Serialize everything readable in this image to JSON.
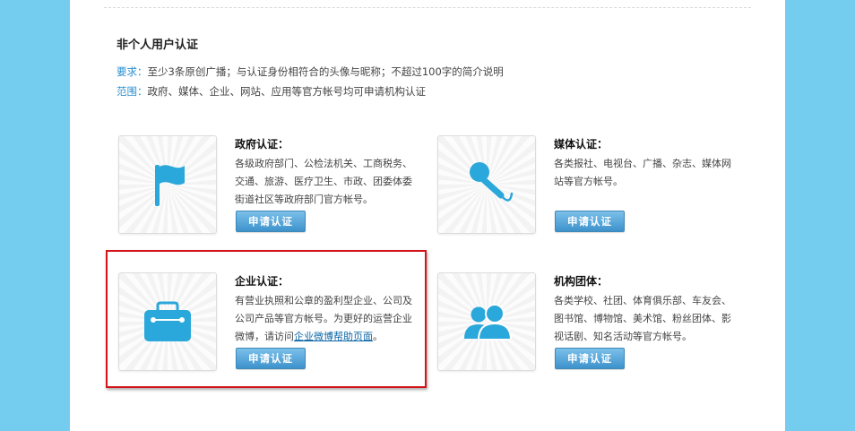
{
  "header": {
    "title": "非个人用户认证",
    "requirement_key": "要求：",
    "requirement_text": "至少3条原创广播；与认证身份相符合的头像与昵称；不超过100字的简介说明",
    "scope_key": "范围：",
    "scope_text": "政府、媒体、企业、网站、应用等官方帐号均可申请机构认证"
  },
  "cards": [
    {
      "title": "政府认证：",
      "icon": "flag-icon",
      "desc": "各级政府部门、公检法机关、工商税务、交通、旅游、医疗卫生、市政、团委体委街道社区等政府部门官方帐号。",
      "button": "申请认证"
    },
    {
      "title": "媒体认证：",
      "icon": "microphone-icon",
      "desc": "各类报社、电视台、广播、杂志、媒体网站等官方帐号。",
      "button": "申请认证"
    },
    {
      "title": "企业认证：",
      "icon": "briefcase-icon",
      "desc_before": "有营业执照和公章的盈利型企业、公司及公司产品等官方帐号。为更好的运营企业微博，请访问",
      "desc_link": "企业微博帮助页面",
      "desc_after": "。",
      "button": "申请认证"
    },
    {
      "title": "机构团体：",
      "icon": "group-icon",
      "desc": "各类学校、社团、体育俱乐部、车友会、图书馆、博物馆、美术馆、粉丝团体、影视话剧、知名活动等官方帐号。",
      "button": "申请认证"
    }
  ],
  "colors": {
    "background": "#74cdee",
    "accent": "#2a8fd0",
    "icon_blue": "#2aa7db",
    "highlight": "#d4141a"
  }
}
